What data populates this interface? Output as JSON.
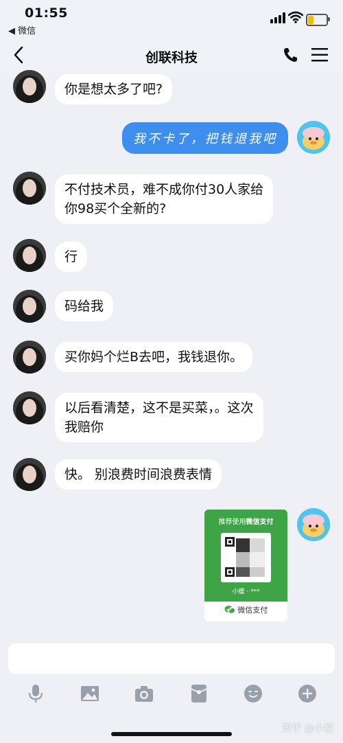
{
  "status_bar": {
    "time": "01:55",
    "back_app": "◀ 微信"
  },
  "nav": {
    "title": "创联科技"
  },
  "messages": [
    {
      "side": "left",
      "text": "你是想太多了吧?"
    },
    {
      "side": "right",
      "text": "我不卡了，把钱退我吧"
    },
    {
      "side": "left",
      "text_line1": "不付技术员，难不成你付30人家给",
      "text_line2": "你98买个全新的?"
    },
    {
      "side": "left",
      "text": "行"
    },
    {
      "side": "left",
      "text": "码给我"
    },
    {
      "side": "left",
      "text": "买你妈个烂B去吧，我钱退你。"
    },
    {
      "side": "left",
      "text_line1": "以后看清楚，这不是买菜，。这次",
      "text_line2": "我赔你"
    },
    {
      "side": "left",
      "text": "快。 别浪费时间浪费表情"
    }
  ],
  "qr_card": {
    "title_prefix": "推荐使用",
    "title_bold": "微信支付",
    "name": "小瘦 · ***",
    "footer": "微信支付"
  },
  "toolbar": {
    "icons": [
      "microphone-icon",
      "image-icon",
      "camera-icon",
      "red-packet-icon",
      "emoji-icon",
      "plus-icon"
    ]
  },
  "watermark": "知乎 @小瘦",
  "colors": {
    "my_bubble": "#3d8fef",
    "background": "#eef0f6",
    "wechat_green": "#3ea547"
  }
}
